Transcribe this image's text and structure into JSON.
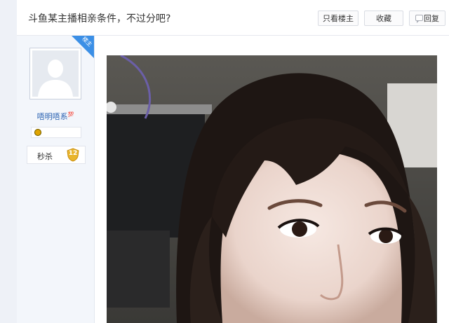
{
  "thread": {
    "title": "斗鱼某主播相亲条件，不过分吧?"
  },
  "actions": {
    "only_owner": "只看楼主",
    "favorite": "收藏",
    "reply": "回复"
  },
  "user": {
    "badge": "楼主",
    "name": "唔明唔系",
    "name_badge": "💯",
    "rank_title": "秒杀",
    "rank_level": "12"
  },
  "colors": {
    "accent": "#3b8fe6",
    "username": "#2d64b3",
    "rank_badge": "#e9b52c"
  }
}
